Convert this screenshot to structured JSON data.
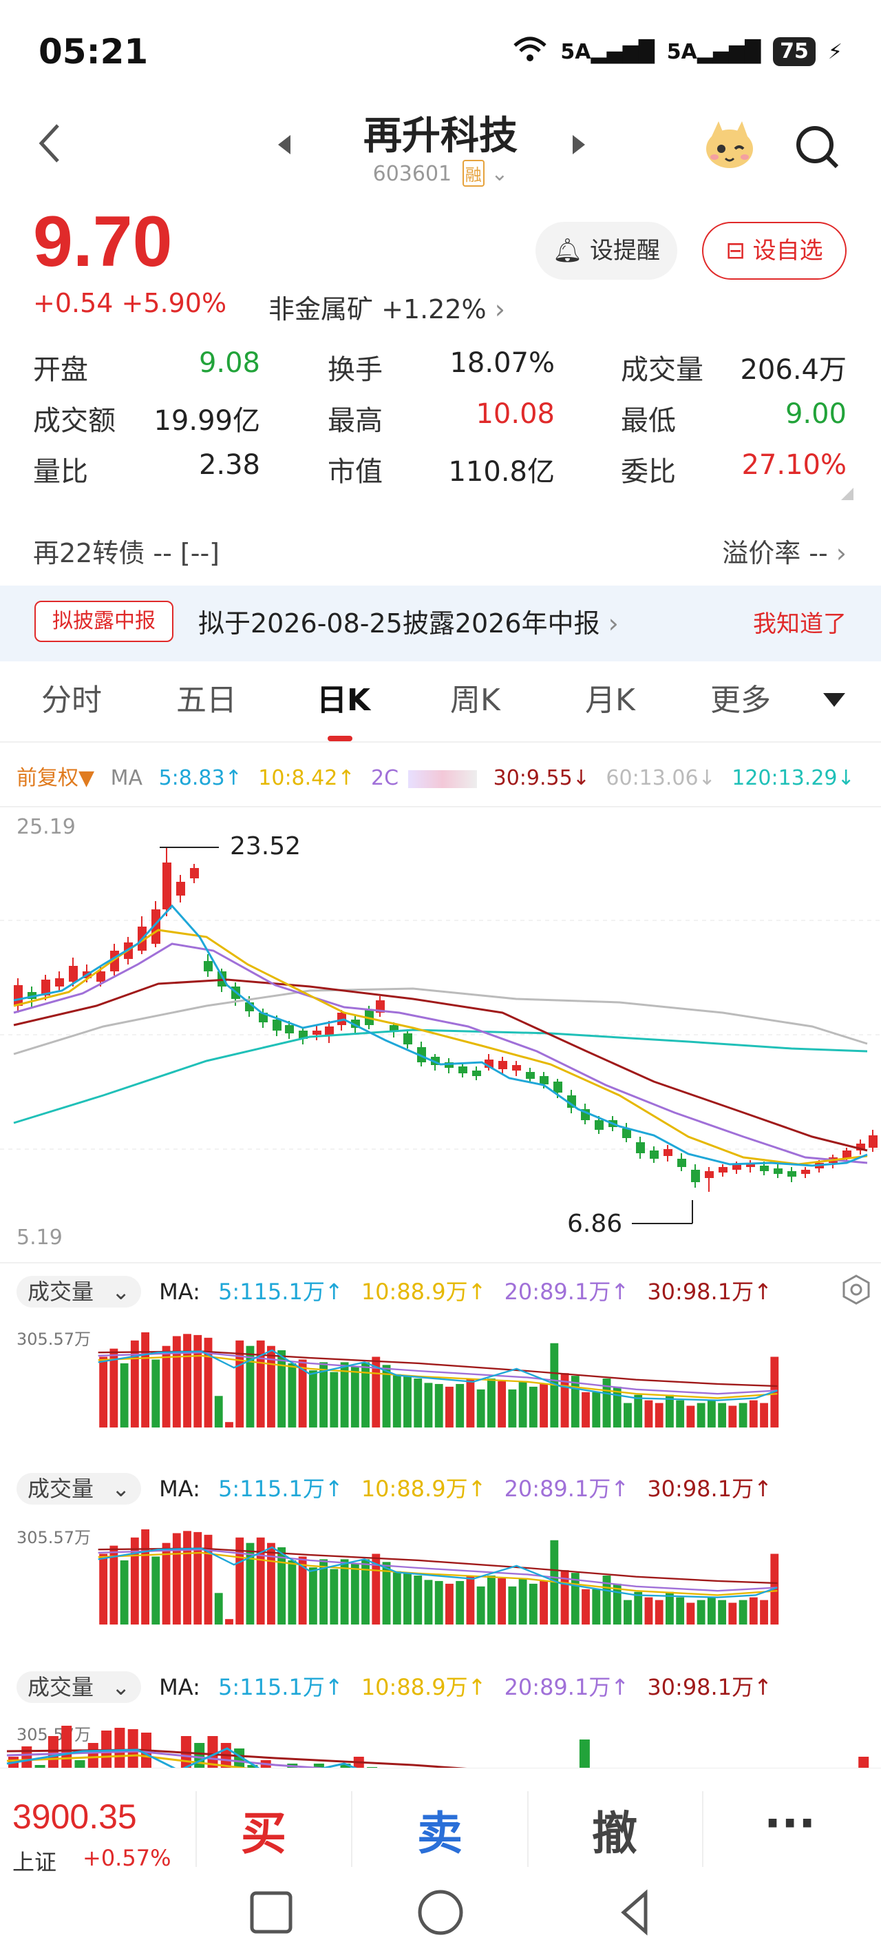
{
  "status": {
    "time": "05:21",
    "signal1": "5A",
    "signal2": "5A",
    "battery": "75"
  },
  "header": {
    "title": "再升科技",
    "code": "603601",
    "rong": "融"
  },
  "quote": {
    "price": "9.70",
    "change": "+0.54 +5.90%",
    "sector": "非金属矿 +1.22%",
    "alert_btn": "设提醒",
    "fav_btn": "设自选"
  },
  "stats": [
    {
      "label": "开盘",
      "value": "9.08",
      "tone": "green"
    },
    {
      "label": "换手",
      "value": "18.07%",
      "tone": "dark"
    },
    {
      "label": "成交量",
      "value": "206.4万",
      "tone": "dark"
    },
    {
      "label": "成交额",
      "value": "19.99亿",
      "tone": "dark"
    },
    {
      "label": "最高",
      "value": "10.08",
      "tone": "red"
    },
    {
      "label": "最低",
      "value": "9.00",
      "tone": "green"
    },
    {
      "label": "量比",
      "value": "2.38",
      "tone": "dark"
    },
    {
      "label": "市值",
      "value": "110.8亿",
      "tone": "dark"
    },
    {
      "label": "委比",
      "value": "27.10%",
      "tone": "red"
    }
  ],
  "bond": {
    "label": "再22转债 --  [--]",
    "premium": "溢价率 --"
  },
  "notice": {
    "tag": "拟披露中报",
    "text": "拟于2026-08-25披露2026年中报",
    "ok": "我知道了"
  },
  "tabs": [
    "分时",
    "五日",
    "日K",
    "周K",
    "月K",
    "更多"
  ],
  "ma": {
    "adjust": "前复权▼",
    "label": "MA",
    "ma5": "5:8.83↑",
    "ma10": "10:8.42↑",
    "ma20": "2C",
    "ma30": "30:9.55↓",
    "ma60": "60:13.06↓",
    "ma120": "120:13.29↓"
  },
  "chart_labels": {
    "top": "25.19",
    "bottom": "5.19",
    "high": "23.52",
    "low": "6.86"
  },
  "volume": {
    "pill": "成交量",
    "ma": "MA:",
    "ma5": "5:115.1万↑",
    "ma10": "10:88.9万↑",
    "ma20": "20:89.1万↑",
    "ma30": "30:98.1万↑",
    "max": "305.57万"
  },
  "bottom": {
    "index_value": "3900.35",
    "index_name": "上证",
    "index_change": "+0.57%",
    "buy": "买",
    "sell": "卖",
    "cancel": "撤",
    "more": "···"
  },
  "colors": {
    "up": "#e02a2a",
    "down": "#22a33a",
    "ma5": "#1fa7d8",
    "ma10": "#e6b800",
    "ma20": "#a070d8",
    "ma30": "#a01a1a",
    "ma60": "#bbbbbb",
    "ma120": "#20c0b8"
  }
}
